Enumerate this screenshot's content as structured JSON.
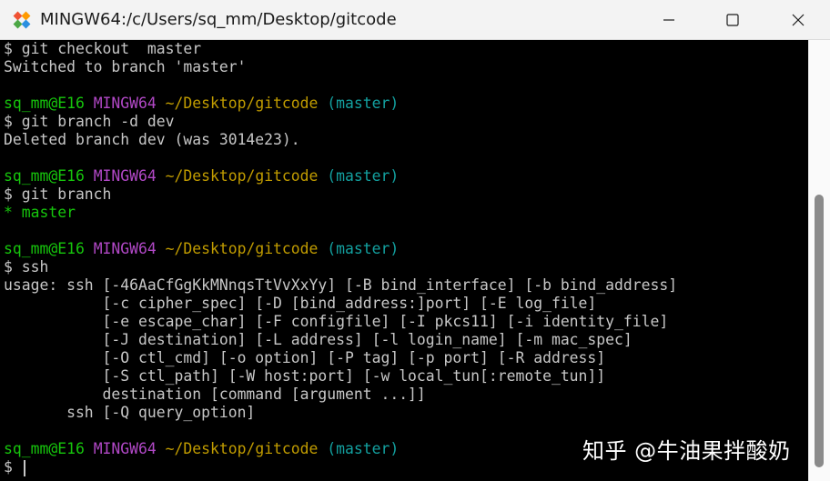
{
  "window": {
    "title": "MINGW64:/c/Users/sq_mm/Desktop/gitcode",
    "icon": "git-diamond-icon",
    "buttons": {
      "minimize": "minimize-icon",
      "maximize": "maximize-icon",
      "close": "close-icon"
    }
  },
  "colors": {
    "user": "#16c60c",
    "mingw": "#b148c6",
    "path": "#c19c00",
    "branch": "#13a1a0",
    "text": "#c7c7c7",
    "background": "#000000"
  },
  "terminal": {
    "l1": "$ git checkout  master",
    "l2": "Switched to branch 'master'",
    "p1": {
      "user": "sq_mm@E16",
      "env": "MINGW64",
      "path": "~/Desktop/gitcode",
      "branch": "(master)"
    },
    "l4": "$ git branch -d dev",
    "l5": "Deleted branch dev (was 3014e23).",
    "p2": {
      "user": "sq_mm@E16",
      "env": "MINGW64",
      "path": "~/Desktop/gitcode",
      "branch": "(master)"
    },
    "l7": "$ git branch",
    "l8": "* master",
    "p3": {
      "user": "sq_mm@E16",
      "env": "MINGW64",
      "path": "~/Desktop/gitcode",
      "branch": "(master)"
    },
    "l10": "$ ssh",
    "usage": [
      "usage: ssh [-46AaCfGgKkMNnqsTtVvXxYy] [-B bind_interface] [-b bind_address]",
      "           [-c cipher_spec] [-D [bind_address:]port] [-E log_file]",
      "           [-e escape_char] [-F configfile] [-I pkcs11] [-i identity_file]",
      "           [-J destination] [-L address] [-l login_name] [-m mac_spec]",
      "           [-O ctl_cmd] [-o option] [-P tag] [-p port] [-R address]",
      "           [-S ctl_path] [-W host:port] [-w local_tun[:remote_tun]]",
      "           destination [command [argument ...]]",
      "       ssh [-Q query_option]"
    ],
    "p4": {
      "user": "sq_mm@E16",
      "env": "MINGW64",
      "path": "~/Desktop/gitcode",
      "branch": "(master)"
    },
    "input_prompt": "$ "
  },
  "watermark": "知乎 @牛油果拌酸奶"
}
